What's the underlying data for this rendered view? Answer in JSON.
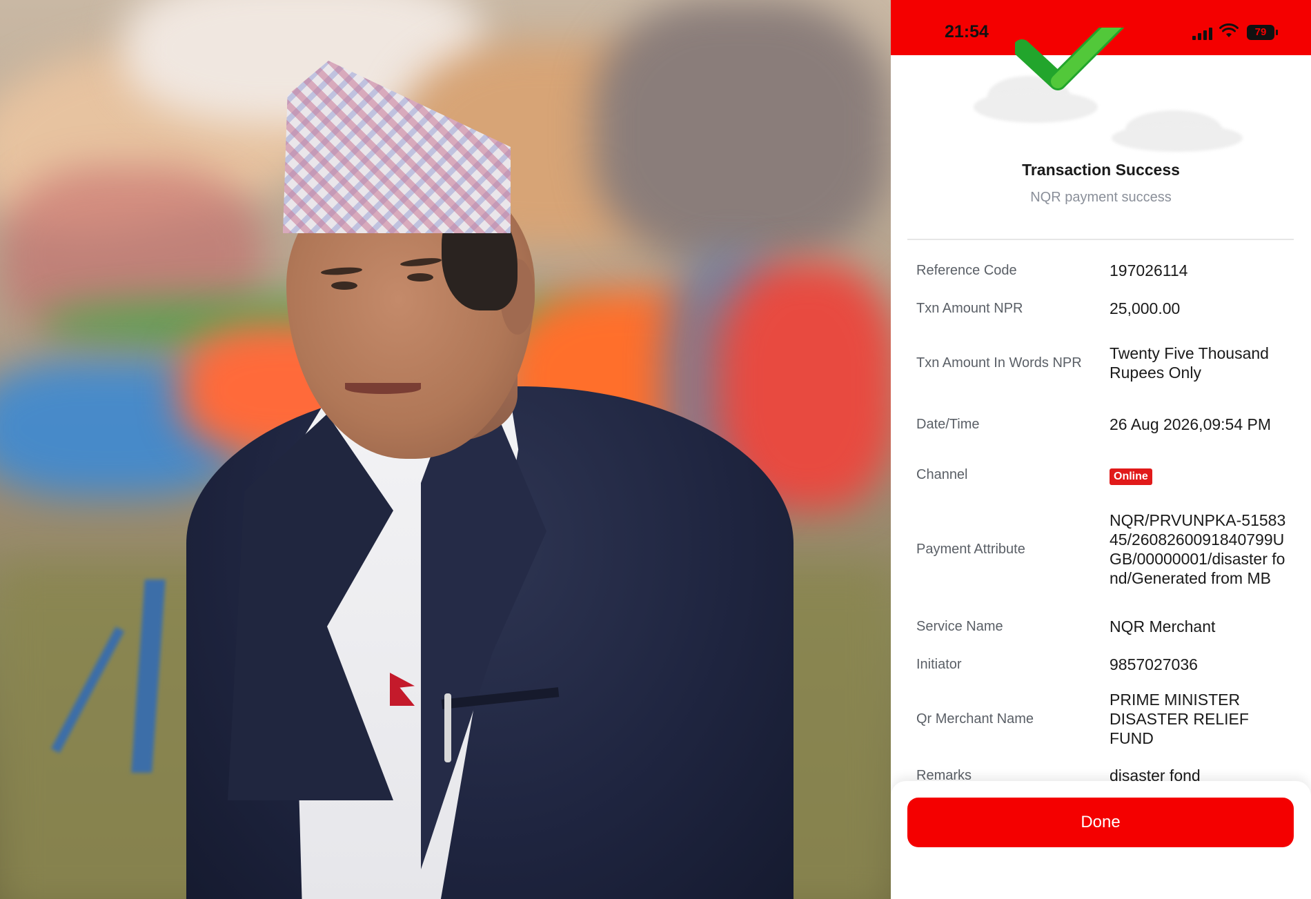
{
  "status_bar": {
    "time": "21:54",
    "battery": "79",
    "signal_icon": "cellular-signal-icon",
    "wifi_icon": "wifi-icon",
    "background_color": "#f40000"
  },
  "photo": {
    "subject": "portrait"
  },
  "receipt": {
    "title": "Transaction Success",
    "subtitle": "NQR payment success",
    "success_icon": "checkmark-icon",
    "rows": [
      {
        "label": "Reference Code",
        "value": "197026114"
      },
      {
        "label": "Txn Amount NPR",
        "value": "25,000.00"
      },
      {
        "label": "Txn Amount In Words NPR",
        "value": "Twenty Five Thousand Rupees Only"
      },
      {
        "label": "Date/Time",
        "value": "26 Aug 2026,09:54 PM"
      },
      {
        "label": "Channel",
        "value": "Online"
      },
      {
        "label": "Payment Attribute",
        "value": "NQR/PRVUNPKA-5158345/2608260091840799UGB/00000001/disaster fond/Generated from MB"
      },
      {
        "label": "Service Name",
        "value": "NQR Merchant"
      },
      {
        "label": "Initiator",
        "value": "9857027036"
      },
      {
        "label": "Qr Merchant Name",
        "value": "PRIME MINISTER DISASTER RELIEF FUND"
      },
      {
        "label": "Remarks",
        "value": "disaster fond"
      }
    ]
  },
  "footer": {
    "done_label": "Done"
  },
  "colors": {
    "accent_red": "#f40000",
    "success_green": "#3cb83c",
    "badge_red": "#e11a1a"
  }
}
